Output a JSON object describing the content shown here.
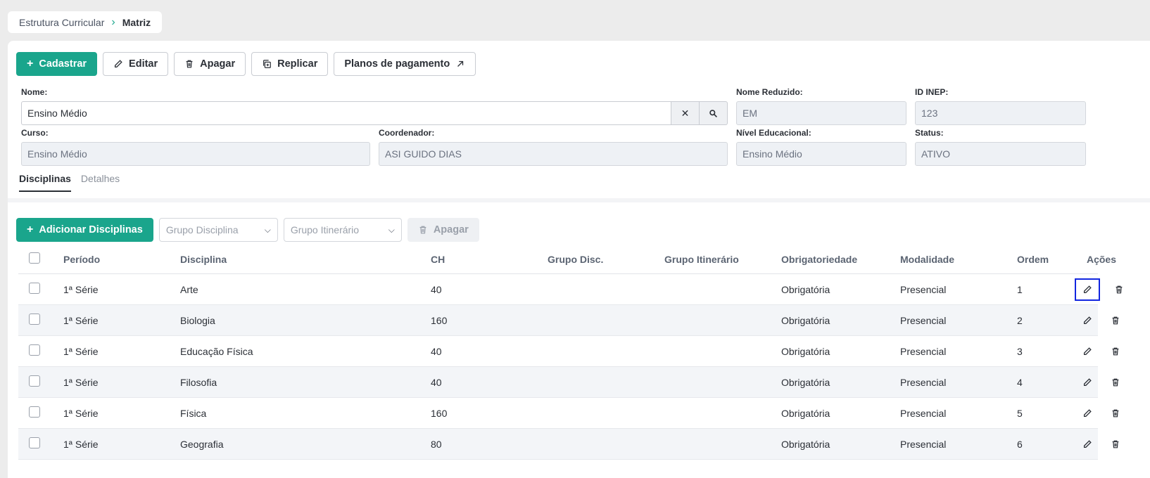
{
  "breadcrumb": {
    "items": [
      "Estrutura Curricular",
      "Matriz"
    ]
  },
  "toolbar": {
    "cadastrar": "Cadastrar",
    "editar": "Editar",
    "apagar": "Apagar",
    "replicar": "Replicar",
    "planos": "Planos de pagamento"
  },
  "form": {
    "nome": {
      "label": "Nome:",
      "value": "Ensino Médio"
    },
    "nome_reduzido": {
      "label": "Nome Reduzido:",
      "value": "EM"
    },
    "id_inep": {
      "label": "ID INEP:",
      "value": "123"
    },
    "curso": {
      "label": "Curso:",
      "value": "Ensino Médio"
    },
    "coordenador": {
      "label": "Coordenador:",
      "value": "ASI GUIDO DIAS"
    },
    "nivel": {
      "label": "Nível Educacional:",
      "value": "Ensino Médio"
    },
    "status": {
      "label": "Status:",
      "value": "ATIVO"
    }
  },
  "tabs": [
    "Disciplinas",
    "Detalhes"
  ],
  "toolbar2": {
    "adicionar": "Adicionar Disciplinas",
    "grupo_disciplina": "Grupo Disciplina",
    "grupo_itinerario": "Grupo Itinerário",
    "apagar": "Apagar"
  },
  "table": {
    "headers": [
      "Período",
      "Disciplina",
      "CH",
      "Grupo Disc.",
      "Grupo Itinerário",
      "Obrigatoriedade",
      "Modalidade",
      "Ordem",
      "Ações"
    ],
    "rows": [
      {
        "periodo": "1ª Série",
        "disciplina": "Arte",
        "ch": "40",
        "grupo_disc": "",
        "grupo_itin": "",
        "obrig": "Obrigatória",
        "modalidade": "Presencial",
        "ordem": "1"
      },
      {
        "periodo": "1ª Série",
        "disciplina": "Biologia",
        "ch": "160",
        "grupo_disc": "",
        "grupo_itin": "",
        "obrig": "Obrigatória",
        "modalidade": "Presencial",
        "ordem": "2"
      },
      {
        "periodo": "1ª Série",
        "disciplina": "Educação Física",
        "ch": "40",
        "grupo_disc": "",
        "grupo_itin": "",
        "obrig": "Obrigatória",
        "modalidade": "Presencial",
        "ordem": "3"
      },
      {
        "periodo": "1ª Série",
        "disciplina": "Filosofia",
        "ch": "40",
        "grupo_disc": "",
        "grupo_itin": "",
        "obrig": "Obrigatória",
        "modalidade": "Presencial",
        "ordem": "4"
      },
      {
        "periodo": "1ª Série",
        "disciplina": "Física",
        "ch": "160",
        "grupo_disc": "",
        "grupo_itin": "",
        "obrig": "Obrigatória",
        "modalidade": "Presencial",
        "ordem": "5"
      },
      {
        "periodo": "1ª Série",
        "disciplina": "Geografia",
        "ch": "80",
        "grupo_disc": "",
        "grupo_itin": "",
        "obrig": "Obrigatória",
        "modalidade": "Presencial",
        "ordem": "6"
      }
    ]
  },
  "colors": {
    "accent": "#1aa58c",
    "focus": "#1226e0"
  }
}
